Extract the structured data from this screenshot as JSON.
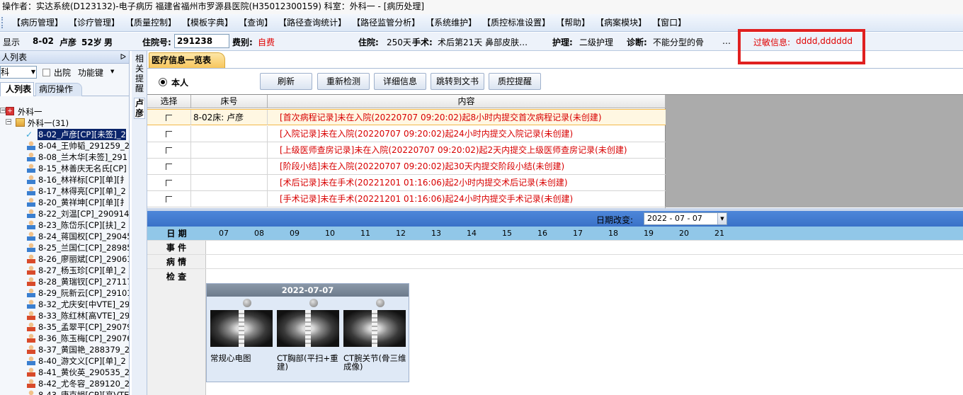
{
  "titlebar": {
    "text": "操作者：实达系统(D123132)-电子病历  福建省福州市罗源县医院(H35012300159)  科室：外科一 - [病历处理]"
  },
  "menu": {
    "items": [
      "【病历管理】",
      "【诊疗管理】",
      "【质量控制】",
      "【模板字典】",
      "【查询】",
      "【路径查询统计】",
      "【路径监管分析】",
      "【系统维护】",
      "【质控标准设置】",
      "【帮助】",
      "【病案模块】",
      "【窗口】"
    ]
  },
  "patient": {
    "show_label": "显示",
    "bed": "8-02",
    "name": "卢彦",
    "age": "52岁",
    "sex": "男",
    "adm_no_label": "住院号:",
    "adm_no": "291238",
    "fee_label": "费别:",
    "fee_type": "自费",
    "stay_label": "住院:",
    "stay_value": "250天",
    "surgery_label": "手术:",
    "surgery_value": "术后第21天  鼻部皮肤…",
    "nursing_label": "护理:",
    "nursing_value": "二级护理",
    "diagnosis_label": "诊断:",
    "diagnosis_value": "不能分型的骨",
    "more": "…",
    "allergy_label": "过敏信息:",
    "allergy_value": "dddd,dddddd"
  },
  "left_panel": {
    "title": "人列表",
    "pin": "ᐅ",
    "dept": "科",
    "discharged_label": "出院",
    "function_label": "功能键",
    "tab_patients": "人列表",
    "tab_ops": "病历操作",
    "tree_root": "外科一",
    "tree_group": "外科一(31)",
    "patients": [
      "8-02_卢彦[CP][未签]_2",
      "8-04_王帅韬_291259_20",
      "8-08_兰木华[未签]_291",
      "8-15_林善庆无名氏[CP]",
      "8-16_林祥标[CP][单][扌",
      "8-17_林得亮[CP][单]_2",
      "8-20_黄祥坤[CP][单][扌",
      "8-22_刘温[CP]_290914_",
      "8-23_陈岱乐[CP][扶]_2",
      "8-24_蒋国权[CP]_29045",
      "8-25_兰国仁[CP]_28985",
      "8-26_廖丽斌[CP]_29061",
      "8-27_杨玉珍[CP][单]_2",
      "8-28_黄瑞钗[CP]_27117",
      "8-29_阮新云[CP]_29101",
      "8-32_尤庆安[中VTE]_29",
      "8-33_陈红林[高VTE]_29",
      "8-35_孟翠平[CP]_29079",
      "8-36_陈玉梅[CP]_29076",
      "8-37_黄国艳_288379_20",
      "8-40_游文义[CP][单]_2",
      "8-41_黄伙英_290535_20",
      "8-42_尤冬容_289120_20",
      "8-43_唐克娟[CP][高VTE"
    ]
  },
  "vtabs": {
    "tab1": "相关提醒",
    "tab2": "卢彦"
  },
  "main": {
    "doc_tab": "医疗信息一览表",
    "radio_label": "本人",
    "buttons": [
      "刷新",
      "重新检测",
      "详细信息",
      "跳转到文书",
      "质控提醒"
    ],
    "grid_headers": [
      "选择",
      "床号",
      "内容"
    ],
    "rows": [
      {
        "bed": "8-02床: 卢彦",
        "content": "[首次病程记录]未在入院(20220707 09:20:02)起8小时内提交首次病程记录(未创建)"
      },
      {
        "bed": "",
        "content": "[入院记录]未在入院(20220707 09:20:02)起24小时内提交入院记录(未创建)"
      },
      {
        "bed": "",
        "content": "[上级医师查房记录]未在入院(20220707 09:20:02)起2天内提交上级医师查房记录(未创建)"
      },
      {
        "bed": "",
        "content": "[阶段小结]未在入院(20220707 09:20:02)起30天内提交阶段小结(未创建)"
      },
      {
        "bed": "",
        "content": "[术后记录]未在手术(20221201 01:16:06)起2小时内提交术后记录(未创建)"
      },
      {
        "bed": "",
        "content": "[手术记录]未在手术(20221201 01:16:06)起24小时内提交手术记录(未创建)"
      }
    ]
  },
  "timeline": {
    "date_change_label": "日期改变:",
    "date_value": "2022 - 07 - 07",
    "rows": {
      "date": "日  期",
      "event": "事  件",
      "condition": "病  情",
      "exam": "检  查"
    },
    "days": [
      "07",
      "08",
      "09",
      "10",
      "11",
      "12",
      "13",
      "14",
      "15",
      "16",
      "17",
      "18",
      "19",
      "20",
      "21"
    ],
    "card": {
      "date": "2022-07-07",
      "items": [
        "常规心电图",
        "CT胸部(平扫+重建)",
        "CT腕关节(骨三维成像)"
      ]
    }
  }
}
